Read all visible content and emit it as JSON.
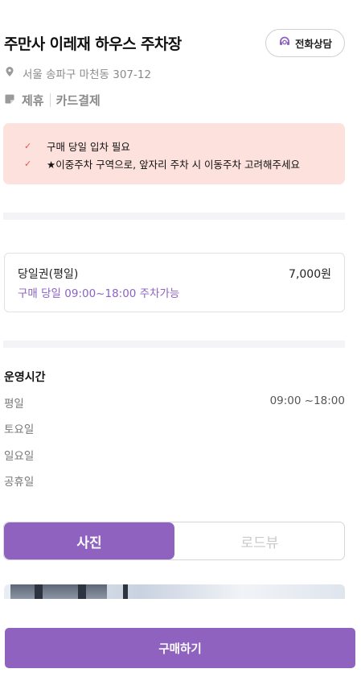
{
  "header": {
    "title": "주만사 이레재 하우스 주차장",
    "call_label": "전화상담"
  },
  "address": "서울 송파구 마천동 307-12",
  "tags": [
    "제휴",
    "카드결제"
  ],
  "notice": {
    "items": [
      "구매 당일 입차 필요",
      "★이중주차 구역으로, 앞자리 주차 시 이동주차 고려해주세요"
    ]
  },
  "ticket": {
    "name": "당일권(평일)",
    "price": "7,000원",
    "description": "구매 당일 09:00~18:00 주차가능"
  },
  "hours": {
    "title": "운영시간",
    "rows": [
      {
        "day": "평일",
        "time": "09:00 ~18:00"
      },
      {
        "day": "토요일",
        "time": ""
      },
      {
        "day": "일요일",
        "time": ""
      },
      {
        "day": "공휴일",
        "time": ""
      }
    ]
  },
  "view_toggle": {
    "options": [
      "사진",
      "로드뷰"
    ],
    "selected": "사진"
  },
  "purchase_label": "구매하기",
  "colors": {
    "accent": "#8e62be",
    "notice_bg": "#fde1dd",
    "check": "#e2574c"
  }
}
